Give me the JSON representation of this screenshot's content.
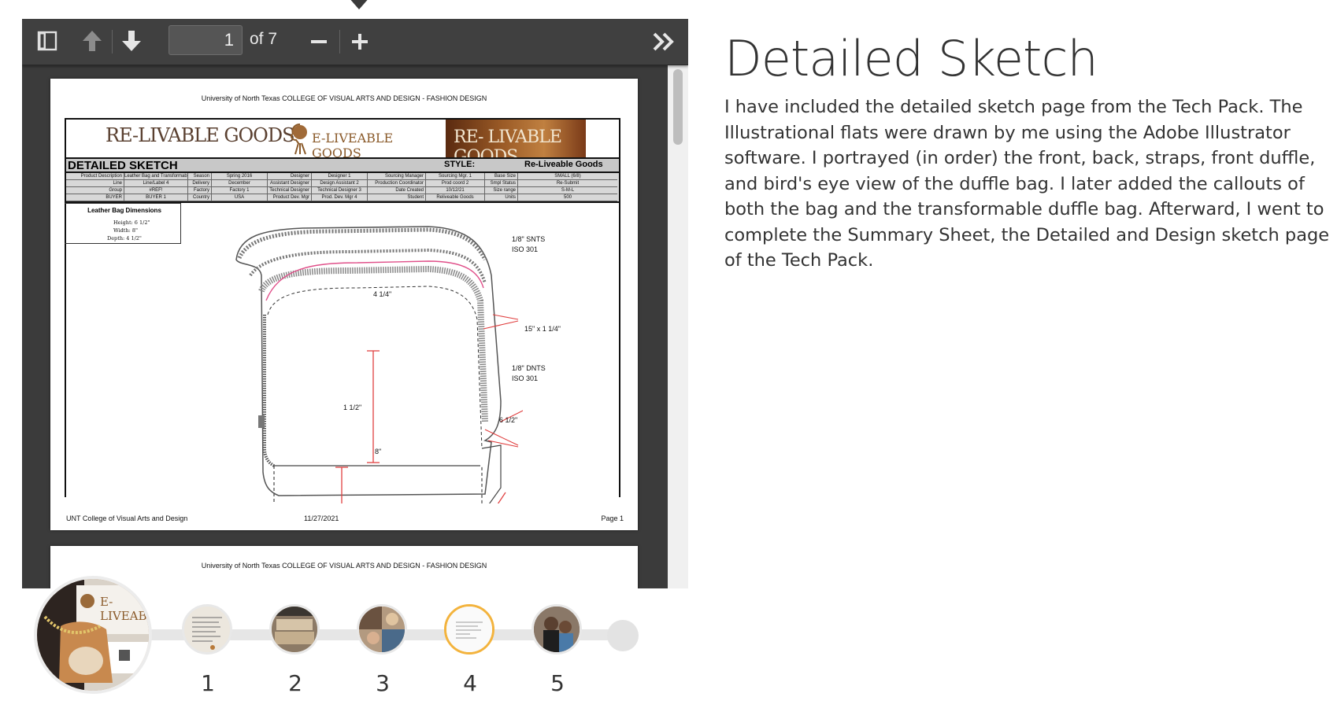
{
  "viewer": {
    "current_page": "1",
    "page_count_label": "of 7"
  },
  "pdf": {
    "header": "University of North Texas COLLEGE OF VISUAL ARTS AND DESIGN - FASHION DESIGN",
    "logos": [
      "RE-LIVABLE GOODS",
      "E-LIVEABLE GOODS",
      "RE- LIVABLE GOODS"
    ],
    "section_title": "DETAILED SKETCH",
    "style_label": "STYLE:",
    "style_value": "Re-Liveable Goods",
    "info_rows": [
      [
        "Product Description",
        "Leather Bag and Transformable Duffle Bag",
        "Season",
        "Spring 2016",
        "Designer",
        "Designer 1",
        "Sourcing Manager",
        "Sourcing Mgr. 1",
        "Base Size",
        "SMALL (6/8)"
      ],
      [
        "Line",
        "Line/Label 4",
        "Delivery",
        "December",
        "Assistant Designer",
        "Design Assistant 2",
        "Production Coordinator",
        "Prod coord 2",
        "Smpl Status",
        "Re-Submit"
      ],
      [
        "Group",
        "#REF!",
        "Factory",
        "Factory 1",
        "Technical Designer",
        "Technical Designer 3",
        "Date Created",
        "10/12/21",
        "Size range",
        "S-M-L"
      ],
      [
        "BUYER",
        "BUYER 1",
        "Country",
        "USA",
        "Product Dev. Mgr",
        "Prod. Dev. Mgr 4",
        "Student",
        "Reliveable Goods",
        "Units",
        "500"
      ]
    ],
    "dimensions": {
      "title": "Leather Bag Dimensions",
      "height": "Height: 6 1/2\"",
      "width": "Width: 8\"",
      "depth": "Depth: 4 1/2\""
    },
    "callouts": {
      "snts": "1/8\" SNTS",
      "iso1": "ISO 301",
      "m1": "4 1/4\"",
      "zip": "15\" x 1 1/4\"",
      "dnts": "1/8\" DNTS",
      "iso2": "ISO 301",
      "m2": "1 1/2\"",
      "m3": "6 1/2\"",
      "m4": "8\""
    },
    "footer_left": "UNT College of Visual Arts and Design",
    "footer_center": "11/27/2021",
    "footer_right": "Page 1",
    "page2_header": "University of North Texas COLLEGE OF VISUAL ARTS AND DESIGN - FASHION DESIGN"
  },
  "content": {
    "title": "Detailed Sketch",
    "description": "I have included the detailed sketch page from the Tech Pack. The Illustrational flats were drawn by me using the Adobe Illustrator software. I portrayed (in order) the front, back, straps, front duffle, and bird's eye view of the duffle bag.  I later added the callouts of both the bag and the transformable duffle bag. Afterward, I went to complete the Summary Sheet, the Detailed and Design sketch page of the Tech Pack."
  },
  "timeline": {
    "cover_logo_text": "E-LIVEABLE",
    "labels": [
      "1",
      "2",
      "3",
      "4",
      "5"
    ],
    "active_index": 4,
    "active_color": "#f3b33d"
  }
}
